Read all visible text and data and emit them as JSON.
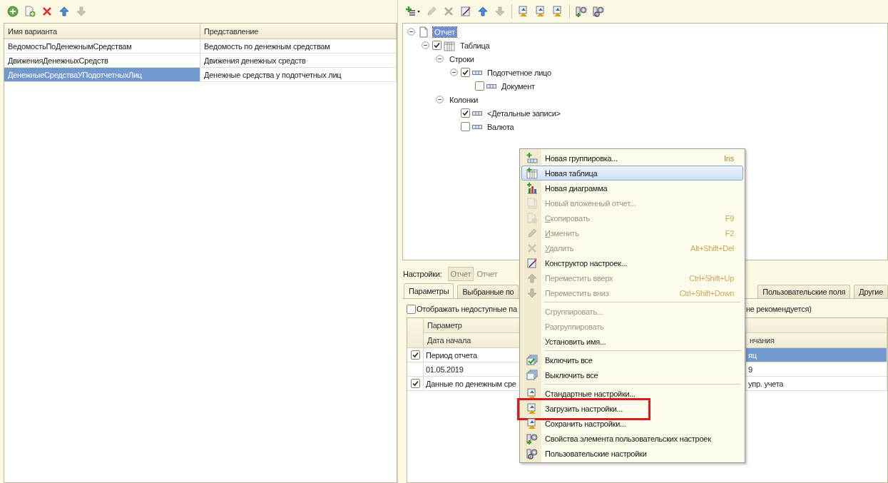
{
  "variants_toolbar": [
    {
      "disabled": false
    },
    {
      "disabled": false
    },
    {
      "disabled": false
    },
    {
      "disabled": false
    },
    {
      "disabled": true
    }
  ],
  "variants_table": {
    "columns": [
      "Имя варианта",
      "Представление"
    ],
    "rows": [
      {
        "name": "ВедомостьПоДенежнымСредствам",
        "presentation": "Ведомость по денежным средствам",
        "selected": false
      },
      {
        "name": "ДвиженияДенежныхСредств",
        "presentation": "Движения денежных средств",
        "selected": false
      },
      {
        "name": "ДенежныеСредстваУПодотчетныхЛиц",
        "presentation": "Денежные средства у подотчетных лиц",
        "selected": true
      }
    ]
  },
  "structure_toolbar": [
    {
      "disabled": false
    },
    {
      "disabled": true
    },
    {
      "disabled": true
    },
    {
      "disabled": false
    },
    {
      "disabled": false
    },
    {
      "disabled": true
    },
    {
      "disabled": false
    },
    {
      "disabled": false
    },
    {
      "disabled": false
    },
    {
      "disabled": false
    },
    {
      "disabled": false
    }
  ],
  "structure_tree": [
    {
      "kind": "report",
      "label": "Отчет",
      "selected": true,
      "expanded": true,
      "children": [
        {
          "kind": "table",
          "label": "Таблица",
          "checked": true,
          "selected": false,
          "expanded": true,
          "children": [
            {
              "kind": "group",
              "label": "Строки",
              "selected": false,
              "expanded": true,
              "children": [
                {
                  "kind": "field",
                  "label": "Подотчетное лицо",
                  "checked": true,
                  "selected": false,
                  "expanded": true,
                  "children": [
                    {
                      "kind": "field",
                      "label": "Документ",
                      "checked": false,
                      "selected": false
                    }
                  ]
                }
              ]
            },
            {
              "kind": "group",
              "label": "Колонки",
              "selected": false,
              "expanded": true,
              "children": [
                {
                  "kind": "field",
                  "label": "<Детальные записи>",
                  "checked": true,
                  "selected": false
                },
                {
                  "kind": "field",
                  "label": "Валюта",
                  "checked": false,
                  "selected": false
                }
              ]
            }
          ]
        }
      ]
    }
  ],
  "settings_bar": {
    "label": "Настройки:",
    "button": "Отчет",
    "value": "Отчет"
  },
  "settings_tabs": [
    {
      "label": "Параметры",
      "selected": true
    },
    {
      "label": "Выбранные по",
      "selected": false
    },
    {
      "label": "Пользовательские поля",
      "selected": false
    },
    {
      "label": "Другие",
      "selected": false
    }
  ],
  "parameters": {
    "show_unavailable": {
      "checked": false,
      "label": "Отображать недоступные па",
      "label_tail": "не рекомендуется)"
    },
    "header": "Параметр",
    "subheader": [
      "Дата начала",
      "нчания"
    ],
    "rows": [
      {
        "kind": "param",
        "checked": true,
        "name": "Период отчета",
        "value": "яц",
        "selected": true
      },
      {
        "kind": "detail",
        "name": "01.05.2019",
        "value": "9",
        "selected": false
      },
      {
        "kind": "param",
        "checked": true,
        "name": "Данные по денежным сре",
        "value": "упр. учета",
        "selected": false
      }
    ]
  },
  "context_menu": {
    "items": [
      {
        "kind": "item",
        "label": "Новая группировка...",
        "shortcut": "Ins",
        "disabled": false,
        "selected": false,
        "mnemonic": false,
        "highlighted": false
      },
      {
        "kind": "item",
        "label": "Новая таблица",
        "disabled": false,
        "selected": true,
        "mnemonic": false,
        "highlighted": false
      },
      {
        "kind": "item",
        "label": "Новая диаграмма",
        "disabled": false,
        "selected": false,
        "mnemonic": false,
        "highlighted": false
      },
      {
        "kind": "item",
        "label": "Новый вложенный отчет...",
        "disabled": true,
        "selected": false,
        "mnemonic": false,
        "highlighted": false
      },
      {
        "kind": "item",
        "label": "Скопировать",
        "shortcut": "F9",
        "disabled": true,
        "selected": false,
        "mnemonic": true,
        "highlighted": false
      },
      {
        "kind": "item",
        "label": "Изменить",
        "shortcut": "F2",
        "disabled": true,
        "selected": false,
        "mnemonic": true,
        "highlighted": false
      },
      {
        "kind": "item",
        "label": "Удалить",
        "shortcut": "Alt+Shift+Del",
        "disabled": true,
        "selected": false,
        "mnemonic": true,
        "highlighted": false
      },
      {
        "kind": "item",
        "label": "Конструктор настроек...",
        "disabled": false,
        "selected": false,
        "mnemonic": false,
        "highlighted": false
      },
      {
        "kind": "item",
        "label": "Переместить вверх",
        "shortcut": "Ctrl+Shift+Up",
        "disabled": true,
        "selected": false,
        "mnemonic": false,
        "highlighted": false
      },
      {
        "kind": "item",
        "label": "Переместить вниз",
        "shortcut": "Ctrl+Shift+Down",
        "disabled": true,
        "selected": false,
        "mnemonic": false,
        "highlighted": false
      },
      {
        "kind": "separator"
      },
      {
        "kind": "item",
        "label": "Сгруппировать...",
        "disabled": true,
        "selected": false,
        "mnemonic": false,
        "highlighted": false
      },
      {
        "kind": "item",
        "label": "Разгруппировать",
        "disabled": true,
        "selected": false,
        "mnemonic": false,
        "highlighted": false
      },
      {
        "kind": "item",
        "label": "Установить имя...",
        "disabled": false,
        "selected": false,
        "mnemonic": false,
        "highlighted": false
      },
      {
        "kind": "separator"
      },
      {
        "kind": "item",
        "label": "Включить все",
        "disabled": false,
        "selected": false,
        "mnemonic": false,
        "highlighted": false
      },
      {
        "kind": "item",
        "label": "Выключить все",
        "disabled": false,
        "selected": false,
        "mnemonic": false,
        "highlighted": false
      },
      {
        "kind": "separator"
      },
      {
        "kind": "item",
        "label": "Стандартные настройки...",
        "disabled": false,
        "selected": false,
        "mnemonic": false,
        "highlighted": false
      },
      {
        "kind": "item",
        "label": "Загрузить настройки...",
        "disabled": false,
        "selected": false,
        "mnemonic": false,
        "highlighted": true
      },
      {
        "kind": "item",
        "label": "Сохранить настройки...",
        "disabled": false,
        "selected": false,
        "mnemonic": false,
        "highlighted": false
      },
      {
        "kind": "item",
        "label": "Свойства элемента пользовательских настроек",
        "disabled": false,
        "selected": false,
        "mnemonic": false,
        "highlighted": false
      },
      {
        "kind": "item",
        "label": "Пользовательские настройки",
        "disabled": false,
        "selected": false,
        "mnemonic": false,
        "highlighted": false
      }
    ]
  }
}
